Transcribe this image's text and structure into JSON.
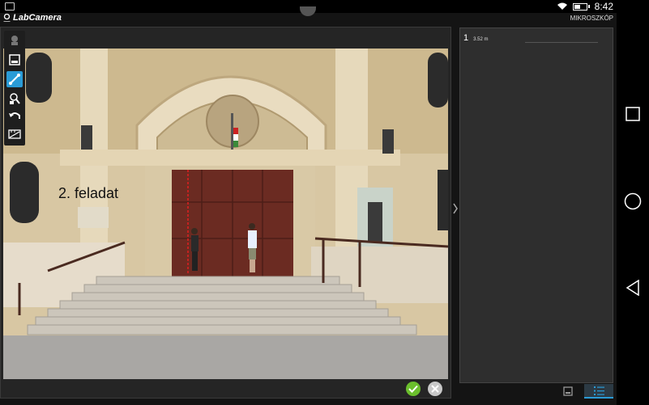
{
  "status": {
    "time": "8:42"
  },
  "app": {
    "title": "LabCamera",
    "mode": "MIKROSZKÓP"
  },
  "photo": {
    "annotation": "2. feladat"
  },
  "toolbar": {
    "tools": [
      "camera-icon",
      "image-icon",
      "measure-ruler-icon",
      "magnifier-person-icon",
      "undo-icon",
      "scale-calibration-icon"
    ],
    "active": "measure-ruler-icon"
  },
  "measurements": [
    {
      "index": "1",
      "value": "3.52 m"
    }
  ],
  "colors": {
    "accent": "#2a9bd6",
    "confirm": "#6bbf2d",
    "measure_line": "#e02020"
  },
  "navigation": [
    "recent-apps-icon",
    "home-icon",
    "back-icon"
  ]
}
